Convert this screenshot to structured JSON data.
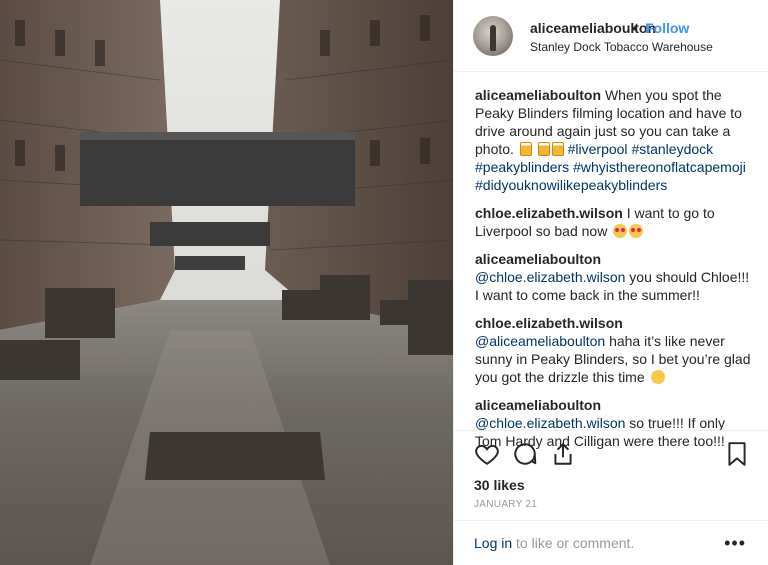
{
  "header": {
    "username": "aliceameliaboulton",
    "separator": "•",
    "follow_label": "Follow",
    "location": "Stanley Dock Tobacco Warehouse"
  },
  "caption": {
    "username": "aliceameliaboulton",
    "text": "When you spot the Peaky Blinders filming location and have to drive around again just so you can take a photo.",
    "hashtags": [
      "#liverpool",
      "#stanleydock",
      "#peakyblinders",
      "#whyisthereonoflatcapemoji",
      "#didyouknowilikepeakyblinders"
    ]
  },
  "comments": [
    {
      "username": "chloe.elizabeth.wilson",
      "mention": "",
      "text": "I want to go to Liverpool so bad now"
    },
    {
      "username": "aliceameliaboulton",
      "mention": "@chloe.elizabeth.wilson",
      "text": "you should Chloe!!! I want to come back in the summer!!"
    },
    {
      "username": "chloe.elizabeth.wilson",
      "mention": "@aliceameliaboulton",
      "text": "haha it’s like never sunny in Peaky Blinders, so I bet you’re glad you got the drizzle this time"
    },
    {
      "username": "aliceameliaboulton",
      "mention": "@chloe.elizabeth.wilson",
      "text": "so true!!! If only Tom Hardy and Cilligan were there too!!!"
    }
  ],
  "actions": {
    "icons": [
      "heart-icon",
      "comment-icon",
      "share-icon",
      "bookmark-icon"
    ],
    "likes": "30 likes",
    "date": "JANUARY 21"
  },
  "footer": {
    "login_link": "Log in",
    "login_text": "to like or comment.",
    "more": "•••"
  },
  "colors": {
    "link_blue": "#3897f0",
    "hashtag_navy": "#003569",
    "muted": "#999999",
    "border": "#efefef"
  }
}
